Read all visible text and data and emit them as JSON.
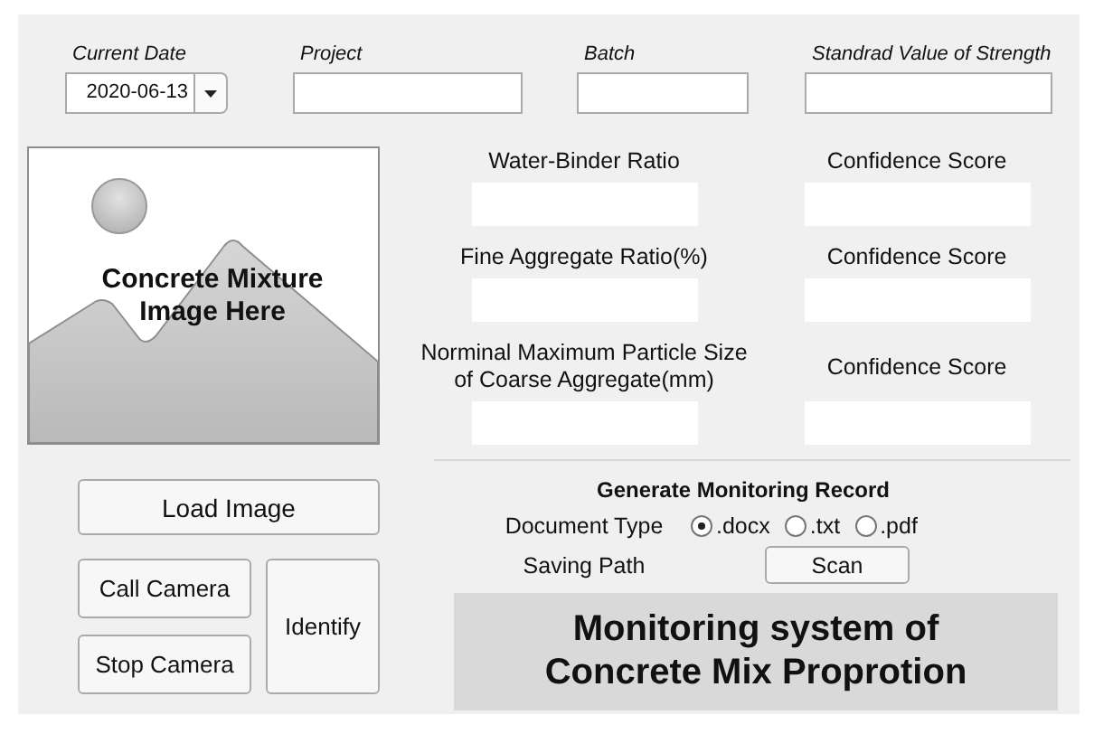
{
  "top_fields": [
    {
      "label": "Current Date",
      "kind": "date",
      "value": "2020-06-13"
    },
    {
      "label": "Project",
      "kind": "text"
    },
    {
      "label": "Batch",
      "kind": "text"
    },
    {
      "label": "Standrad Value of Strength",
      "kind": "text"
    }
  ],
  "image_placeholder": {
    "text": "Concrete Mixture Image Here"
  },
  "left_buttons": {
    "load": "Load Image",
    "call": "Call Camera",
    "stop": "Stop Camera",
    "identify": "Identify"
  },
  "outputs": [
    {
      "label": "Water-Binder Ratio",
      "confidence_label": "Confidence Score"
    },
    {
      "label": "Fine Aggregate Ratio(%)",
      "confidence_label": "Confidence Score"
    },
    {
      "label": "Norminal Maximum Particle Size of Coarse Aggregate(mm)",
      "confidence_label": "Confidence Score"
    }
  ],
  "record": {
    "title": "Generate Monitoring Record",
    "document_type_label": "Document Type",
    "options": [
      {
        "label": ".docx",
        "selected": true
      },
      {
        "label": ".txt",
        "selected": false
      },
      {
        "label": ".pdf",
        "selected": false
      }
    ],
    "saving_path_label": "Saving Path",
    "scan_button": "Scan"
  },
  "banner": "Monitoring system of Concrete Mix Proprotion"
}
